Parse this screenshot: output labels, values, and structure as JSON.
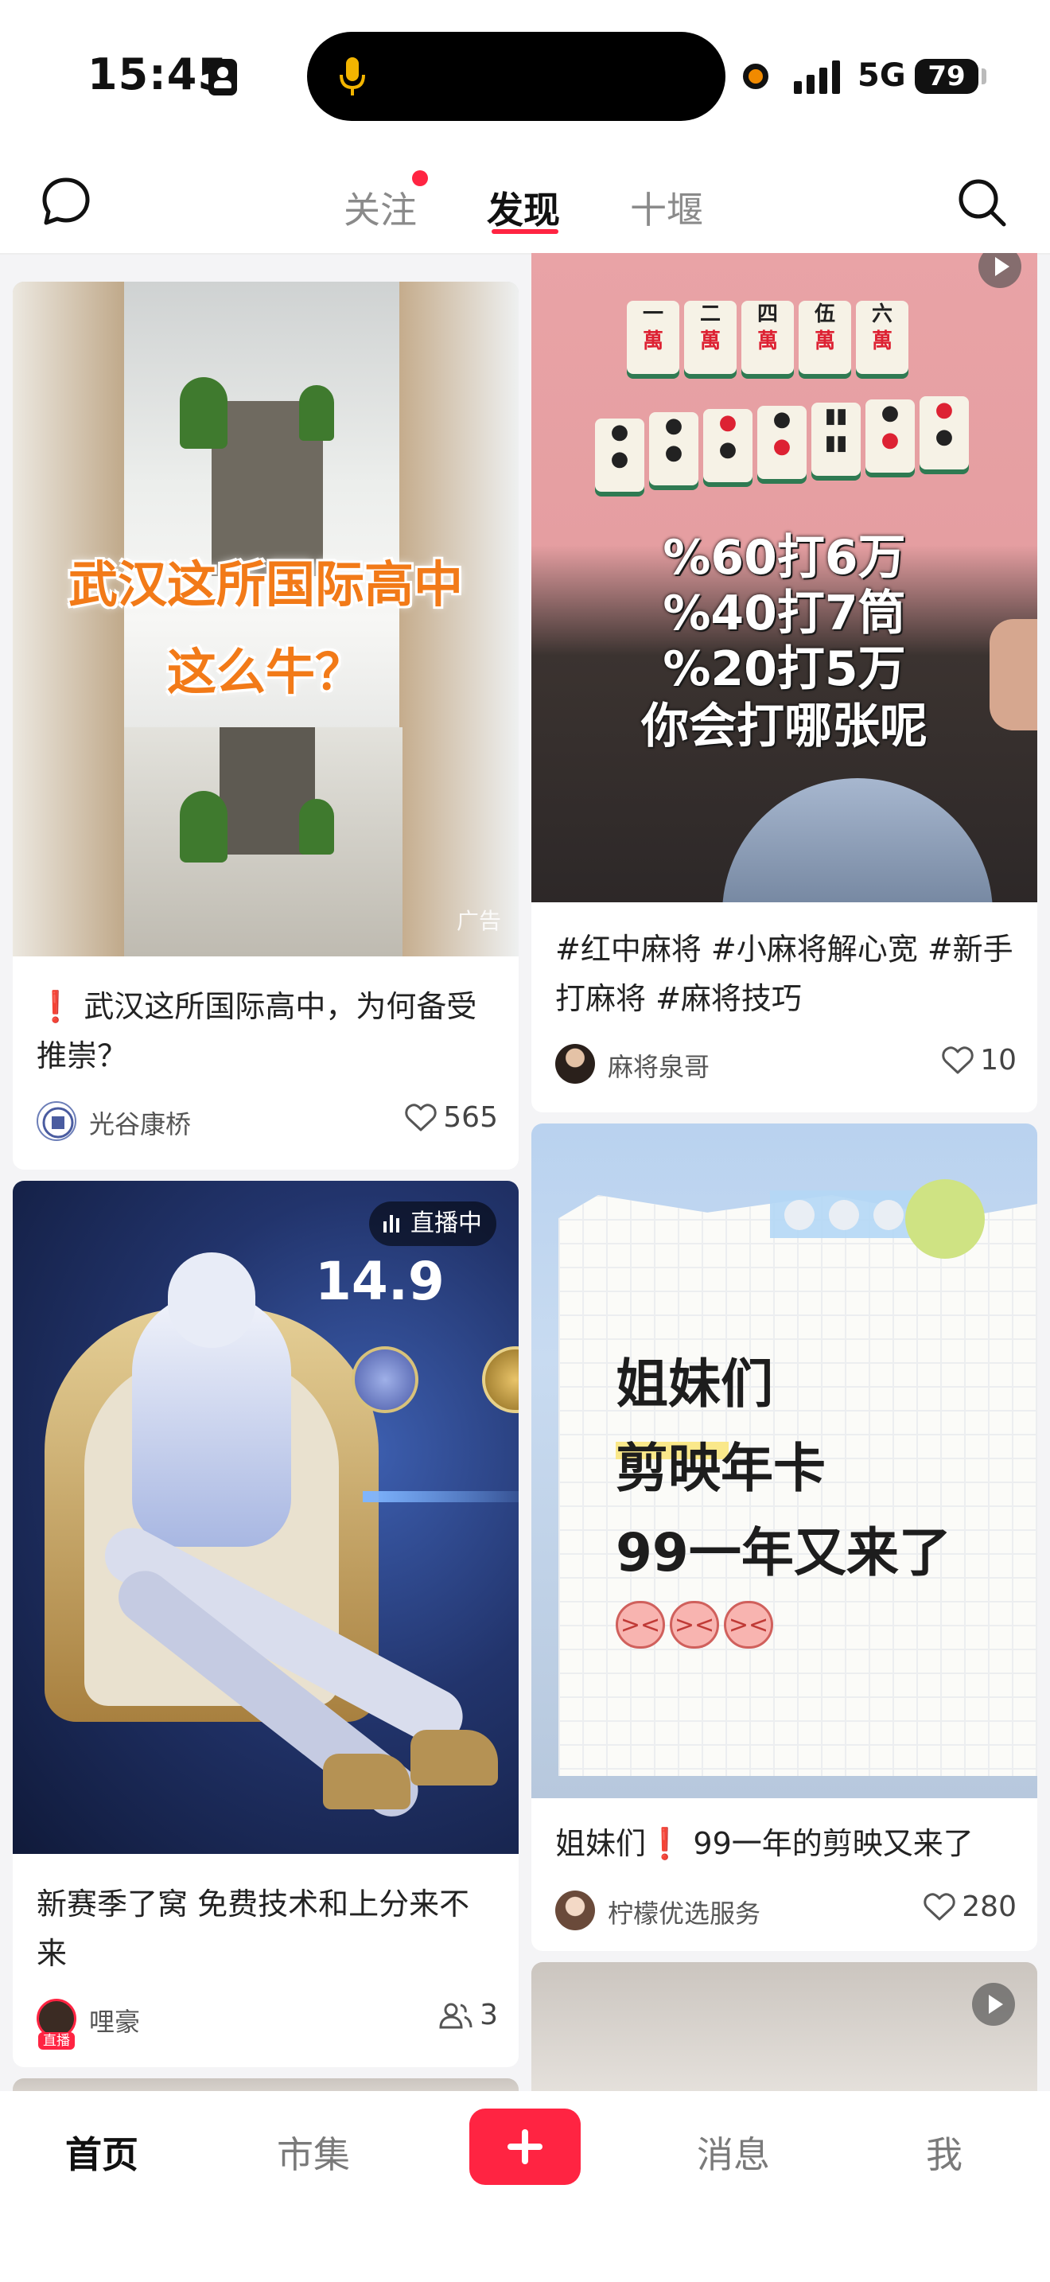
{
  "status_bar": {
    "time": "15:45",
    "network": "5G",
    "battery": "79"
  },
  "top_nav": {
    "tabs": [
      {
        "label": "关注",
        "active": false,
        "has_dot": true
      },
      {
        "label": "发现",
        "active": true
      },
      {
        "label": "十堰",
        "active": false
      }
    ]
  },
  "feed": {
    "left": [
      {
        "overlay_lines": [
          "武汉这所国际高中",
          "这么牛？"
        ],
        "ad_tag": "广告",
        "title": "❗ 武汉这所国际高中，为何备受推崇？",
        "author": "光谷康桥",
        "likes": "565"
      },
      {
        "live_label": "直播中",
        "game_score": "14.9",
        "title": "新赛季了窝 免费技术和上分来不来",
        "author": "哩豪",
        "avatar_badge": "直播",
        "viewers": "3"
      }
    ],
    "right": [
      {
        "overlay_lines": [
          "%60打6万",
          "%40打7筒",
          "%20打5万",
          "你会打哪张呢"
        ],
        "title": "#红中麻将 #小麻将解心宽 #新手打麻将 #麻将技巧",
        "author": "麻将泉哥",
        "likes": "10"
      },
      {
        "note_lines": [
          "姐妹们",
          "剪映年卡",
          "99一年又来了"
        ],
        "title": "姐妹们❗ 99一年的剪映又来了",
        "author": "柠檬优选服务",
        "likes": "280"
      }
    ]
  },
  "bottom_nav": {
    "tabs": [
      {
        "label": "首页",
        "active": true
      },
      {
        "label": "市集",
        "active": false
      },
      {
        "label": "消息",
        "active": false
      },
      {
        "label": "我",
        "active": false
      }
    ]
  },
  "colors": {
    "accent": "#ff2442"
  }
}
